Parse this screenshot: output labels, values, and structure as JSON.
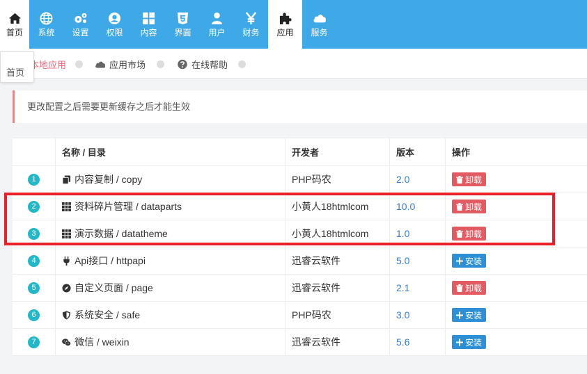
{
  "nav": {
    "items": [
      {
        "label": "首页",
        "icon": "home-icon",
        "active": true
      },
      {
        "label": "系统",
        "icon": "globe-icon"
      },
      {
        "label": "设置",
        "icon": "gears-icon"
      },
      {
        "label": "权限",
        "icon": "user-circle-icon"
      },
      {
        "label": "内容",
        "icon": "grid-icon"
      },
      {
        "label": "界面",
        "icon": "html5-icon"
      },
      {
        "label": "用户",
        "icon": "user-icon"
      },
      {
        "label": "财务",
        "icon": "yen-icon"
      },
      {
        "label": "应用",
        "icon": "puzzle-icon",
        "active": true
      },
      {
        "label": "服务",
        "icon": "cloud-icon"
      }
    ]
  },
  "tooltip": "首页",
  "subnav": {
    "local_apps": "本地应用",
    "market": "应用市场",
    "help": "在线帮助"
  },
  "alert": "更改配置之后需要更新缓存之后才能生效",
  "table": {
    "headers": {
      "name": "名称 / 目录",
      "developer": "开发者",
      "version": "版本",
      "action": "操作"
    },
    "rows": [
      {
        "num": "1",
        "icon": "copy-icon",
        "name": "内容复制 / copy",
        "developer": "PHP码农",
        "version": "2.0",
        "action": "卸载",
        "type": "uninstall"
      },
      {
        "num": "2",
        "icon": "th-icon",
        "name": "资料碎片管理 / dataparts",
        "developer": "小黄人18htmlcom",
        "version": "10.0",
        "action": "卸载",
        "type": "uninstall"
      },
      {
        "num": "3",
        "icon": "th-icon",
        "name": "演示数据 / datatheme",
        "developer": "小黄人18htmlcom",
        "version": "1.0",
        "action": "卸载",
        "type": "uninstall"
      },
      {
        "num": "4",
        "icon": "plug-icon",
        "name": "Api接口 / httpapi",
        "developer": "迅睿云软件",
        "version": "5.0",
        "action": "安装",
        "type": "install"
      },
      {
        "num": "5",
        "icon": "compass-icon",
        "name": "自定义页面 / page",
        "developer": "迅睿云软件",
        "version": "2.1",
        "action": "卸载",
        "type": "uninstall"
      },
      {
        "num": "6",
        "icon": "shield-icon",
        "name": "系统安全 / safe",
        "developer": "PHP码农",
        "version": "3.0",
        "action": "安装",
        "type": "install"
      },
      {
        "num": "7",
        "icon": "wechat-icon",
        "name": "微信 / weixin",
        "developer": "迅睿云软件",
        "version": "5.6",
        "action": "安装",
        "type": "install"
      }
    ]
  },
  "colors": {
    "topbar": "#3fa9e8",
    "danger": "#e25a62",
    "primary": "#2e8ed6",
    "badge": "#23b7c8",
    "highlight": "#e8202a"
  }
}
